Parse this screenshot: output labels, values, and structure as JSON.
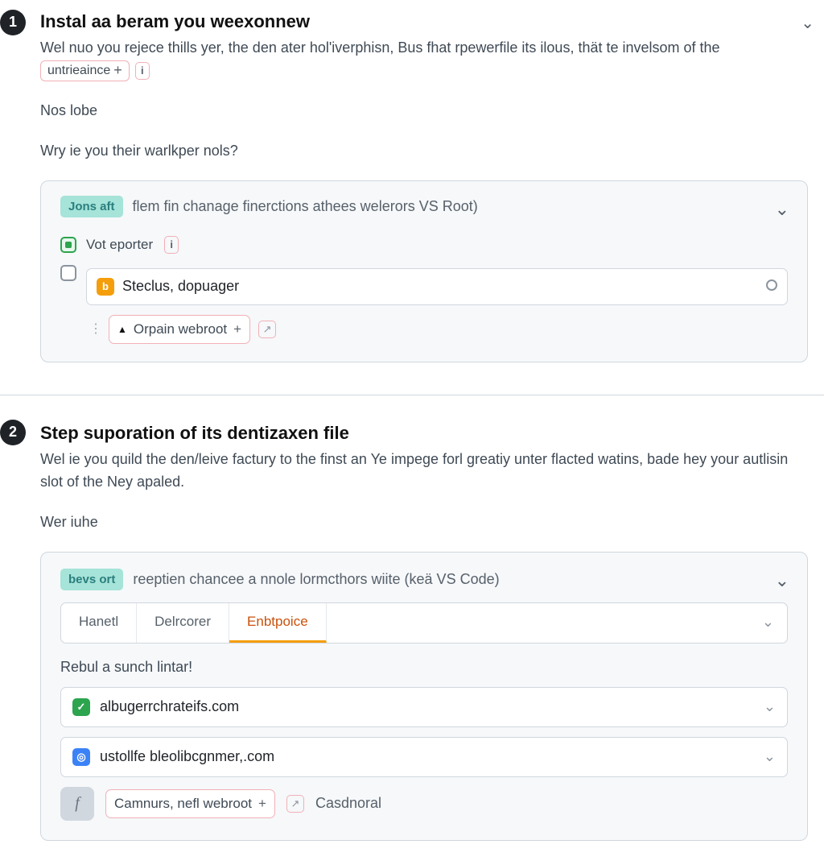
{
  "step1": {
    "num": "1",
    "title": "Instal aa beram you weexonnew",
    "desc_before": "Wel nuo you rejece thills yer, the den ater hol'iverphisn, Bus fhat rpewerfile its ilous, thät te invelsom of the",
    "inline_tag": "untrieaince",
    "para1": "Nos lobe",
    "para2": "Wry ie you their warlkper nols?",
    "card": {
      "badge": "Jons aft",
      "subtitle": "flem fin chanage finerctions athees welerors VS Root)",
      "row1": {
        "checked": true,
        "label": "Vot eporter"
      },
      "row2": {
        "icon": "b",
        "label": "Steclus, dopuager"
      },
      "pill": "Orpain webroot"
    }
  },
  "step2": {
    "num": "2",
    "title": "Step suporation of its dentizaxen file",
    "desc": "Wel ie you quild the den/leive factury to the finst an Ye impege forl greatiy unter flacted watins, bade hey your autlisin slot of the Ney apaled.",
    "para1": "Wer iuhe",
    "card": {
      "badge": "bevs ort",
      "subtitle": "reeptien chancee a nnole lormcthors wiite (keä VS Code)",
      "tabs": [
        "Hanetl",
        "Delrcorer",
        "Enbtpoice"
      ],
      "active_tab": 2,
      "sub_heading": "Rebul a sunch lintar!",
      "domains": [
        "albugerrchrateifs.com",
        "ustollfe bleolibcgnmer,.com"
      ],
      "action_pill": "Camnurs, nefl webroot",
      "cancel": "Casdnoral"
    }
  }
}
